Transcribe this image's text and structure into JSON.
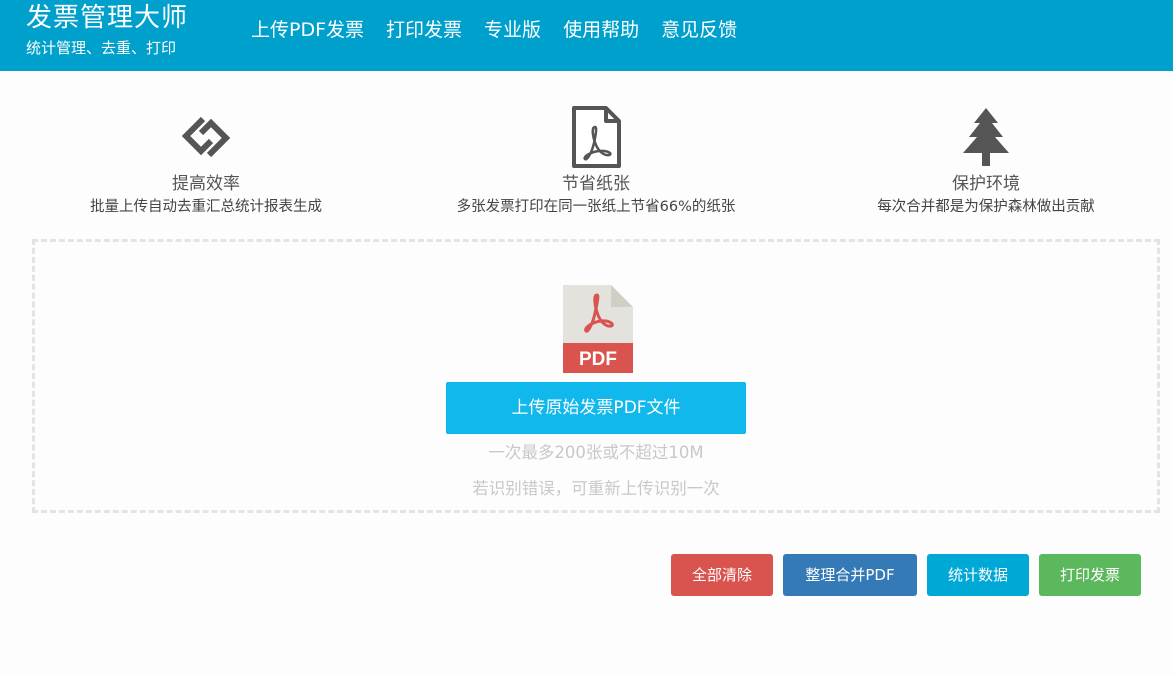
{
  "header": {
    "title": "发票管理大师",
    "subtitle": "统计管理、去重、打印",
    "nav": [
      "上传PDF发票",
      "打印发票",
      "专业版",
      "使用帮助",
      "意见反馈"
    ]
  },
  "features": [
    {
      "icon": "link-icon",
      "title": "提高效率",
      "desc": "批量上传自动去重汇总统计报表生成"
    },
    {
      "icon": "pdf-document-icon",
      "title": "节省纸张",
      "desc": "多张发票打印在同一张纸上节省66%的纸张"
    },
    {
      "icon": "tree-icon",
      "title": "保护环境",
      "desc": "每次合并都是为保护森林做出贡献"
    }
  ],
  "upload": {
    "icon_label": "PDF",
    "button": "上传原始发票PDF文件",
    "hint_limit": "一次最多200张或不超过10M",
    "hint_retry": "若识别错误，可重新上传识别一次"
  },
  "actions": {
    "clear": "全部清除",
    "merge": "整理合并PDF",
    "stats": "统计数据",
    "print": "打印发票"
  },
  "colors": {
    "header_bg": "#00a0cc",
    "upload_button": "#10b8ec",
    "clear": "#d9534f",
    "merge": "#337ab7",
    "stats": "#00a8d6",
    "print": "#5cb85c"
  }
}
